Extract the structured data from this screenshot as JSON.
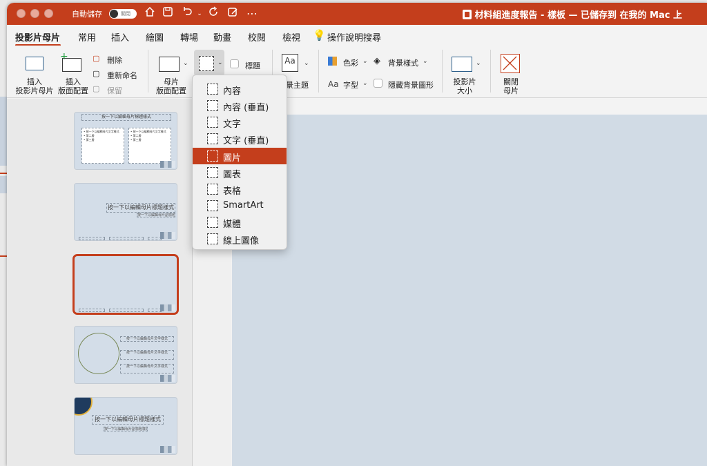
{
  "colors": {
    "accent": "#c43e1c",
    "canvas": "#d1dbe5"
  },
  "titlebar": {
    "autosave_label": "自動儲存",
    "toggle_state": "關閉",
    "document_title": "材料組進度報告 - 樣板 — 已儲存到 在我的 Mac 上",
    "icons": [
      "home-icon",
      "save-icon",
      "undo-icon",
      "redo-icon",
      "edit-icon",
      "more-icon"
    ]
  },
  "tabs": [
    {
      "label": "投影片母片",
      "active": true
    },
    {
      "label": "常用"
    },
    {
      "label": "插入"
    },
    {
      "label": "繪圖"
    },
    {
      "label": "轉場"
    },
    {
      "label": "動畫"
    },
    {
      "label": "校閱"
    },
    {
      "label": "檢視"
    },
    {
      "label": "操作說明搜尋"
    }
  ],
  "ribbon": {
    "insert_slide_master": "插入\n投影片母片",
    "insert_layout": "插入\n版面配置",
    "delete": "刪除",
    "rename": "重新命名",
    "preserve": "保留",
    "master_layout": "母片\n版面配置",
    "title_checkbox": "標題",
    "theme": "佈景主題",
    "theme_partial": "景主題",
    "colors": "色彩",
    "background_styles": "背景樣式",
    "fonts": "字型",
    "hide_background": "隱藏背景圖形",
    "slide_size": "投影片\n大小",
    "close_master": "關閉\n母片"
  },
  "placeholder_menu": {
    "items": [
      {
        "label": "內容",
        "icon": "content-placeholder-icon"
      },
      {
        "label": "內容 (垂直)",
        "icon": "content-vertical-placeholder-icon"
      },
      {
        "label": "文字",
        "icon": "text-placeholder-icon"
      },
      {
        "label": "文字 (垂直)",
        "icon": "text-vertical-placeholder-icon"
      },
      {
        "label": "圖片",
        "icon": "picture-placeholder-icon",
        "highlighted": true
      },
      {
        "label": "圖表",
        "icon": "chart-placeholder-icon"
      },
      {
        "label": "表格",
        "icon": "table-placeholder-icon"
      },
      {
        "label": "SmartArt",
        "icon": "smartart-placeholder-icon"
      },
      {
        "label": "媒體",
        "icon": "media-placeholder-icon"
      },
      {
        "label": "線上圖像",
        "icon": "online-image-placeholder-icon"
      }
    ]
  },
  "thumbnails": {
    "t1_title": "按一下以編輯母片標題樣式",
    "t1_body": "• 按一下以編輯母片文字樣式\n  • 第二層\n    • 第三層",
    "t2_title": "按一下以編輯母片標題樣式",
    "t2_sub": "按一下以編輯母片副標題樣式",
    "t4_text": "按一下以編輯母片文字樣式",
    "t5_title": "按一下以編輯母片標題樣式",
    "t5_sub": "按一下以編輯母片副標題樣式"
  }
}
